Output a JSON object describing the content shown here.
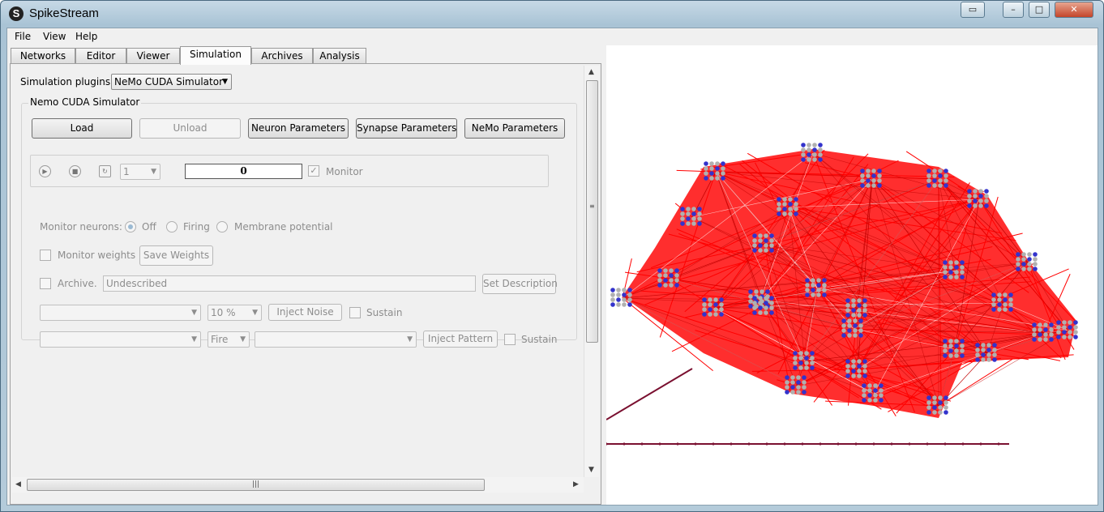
{
  "window": {
    "title": "SpikeStream",
    "app_icon_letter": "S"
  },
  "menu": [
    "File",
    "View",
    "Help"
  ],
  "tabs": [
    "Networks",
    "Editor",
    "Viewer",
    "Simulation",
    "Archives",
    "Analysis"
  ],
  "simulation": {
    "plugins_label": "Simulation plugins:",
    "plugin_selected": "NeMo CUDA Simulator",
    "group_title": "Nemo CUDA Simulator",
    "buttons": {
      "load": "Load",
      "unload": "Unload",
      "neuron_params": "Neuron Parameters",
      "synapse_params": "Synapse Parameters",
      "nemo_params": "NeMo Parameters"
    },
    "toolbar": {
      "step_value": "1",
      "time_step": "0",
      "monitor_label": "Monitor"
    },
    "monitor_neurons": {
      "label": "Monitor neurons:",
      "options": [
        "Off",
        "Firing",
        "Membrane potential"
      ]
    },
    "monitor_weights_label": "Monitor weights",
    "save_weights": "Save Weights",
    "archive": {
      "label": "Archive.",
      "description": "Undescribed",
      "set_description": "Set Description"
    },
    "noise": {
      "percent": "10 %",
      "inject": "Inject Noise",
      "sustain": "Sustain"
    },
    "pattern": {
      "mode": "Fire",
      "inject": "Inject Pattern",
      "sustain": "Sustain"
    }
  },
  "viewer": {
    "connection_color": "#ff0000",
    "excitatory_neuron_color": "#3333cc",
    "neuron_color": "#b0b0b0"
  }
}
